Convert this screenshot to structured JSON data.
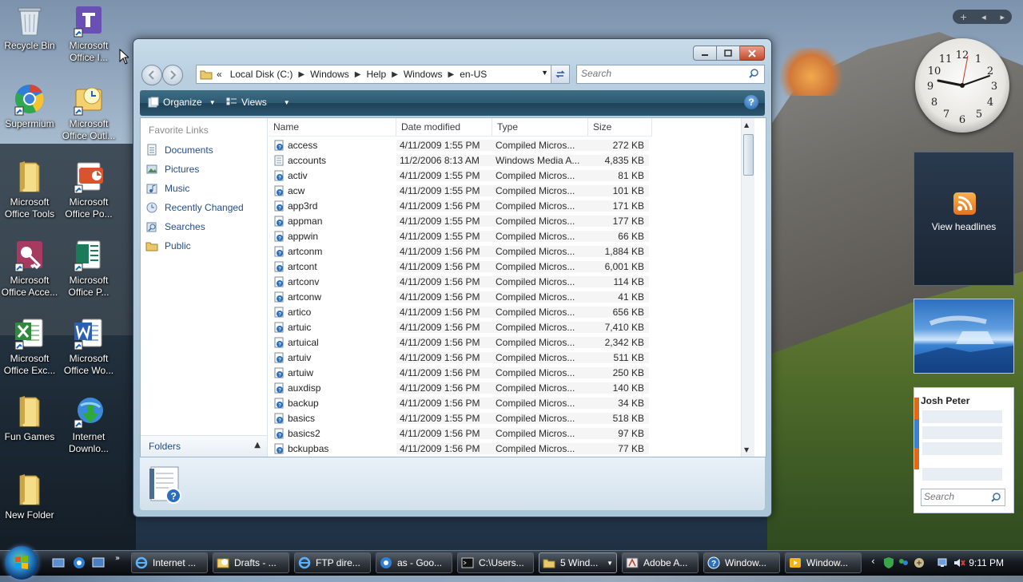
{
  "desktop": {
    "icons": [
      {
        "label": "Recycle Bin",
        "icon": "recycle-bin-icon"
      },
      {
        "label": "Microsoft Office I...",
        "icon": "infopath-icon"
      },
      {
        "label": "Supermium",
        "icon": "browser-icon"
      },
      {
        "label": "Microsoft Office Outl...",
        "icon": "outlook-icon"
      },
      {
        "label": "Microsoft Office Tools",
        "icon": "folder-icon"
      },
      {
        "label": "Microsoft Office Po...",
        "icon": "powerpoint-icon"
      },
      {
        "label": "Microsoft Office Acce...",
        "icon": "access-icon"
      },
      {
        "label": "Microsoft Office P...",
        "icon": "publisher-icon"
      },
      {
        "label": "Microsoft Office Exc...",
        "icon": "excel-icon"
      },
      {
        "label": "Microsoft Office Wo...",
        "icon": "word-icon"
      },
      {
        "label": "Fun Games",
        "icon": "folder-icon"
      },
      {
        "label": "Internet Downlo...",
        "icon": "download-manager-icon"
      },
      {
        "label": "New Folder",
        "icon": "folder-icon"
      }
    ]
  },
  "explorer": {
    "address": [
      "«",
      "Local Disk (C:)",
      "Windows",
      "Help",
      "Windows",
      "en-US"
    ],
    "search_placeholder": "Search",
    "toolbar": {
      "organize": "Organize",
      "views": "Views"
    },
    "favorite_links_title": "Favorite Links",
    "favorite_links": [
      "Documents",
      "Pictures",
      "Music",
      "Recently Changed",
      "Searches",
      "Public"
    ],
    "folders_label": "Folders",
    "columns": {
      "name": "Name",
      "date": "Date modified",
      "type": "Type",
      "size": "Size"
    },
    "files": [
      {
        "name": "access",
        "date": "4/11/2009 1:55 PM",
        "type": "Compiled Micros...",
        "size": "272 KB"
      },
      {
        "name": "accounts",
        "date": "11/2/2006 8:13 AM",
        "type": "Windows Media A...",
        "size": "4,835 KB"
      },
      {
        "name": "activ",
        "date": "4/11/2009 1:55 PM",
        "type": "Compiled Micros...",
        "size": "81 KB"
      },
      {
        "name": "acw",
        "date": "4/11/2009 1:55 PM",
        "type": "Compiled Micros...",
        "size": "101 KB"
      },
      {
        "name": "app3rd",
        "date": "4/11/2009 1:56 PM",
        "type": "Compiled Micros...",
        "size": "171 KB"
      },
      {
        "name": "appman",
        "date": "4/11/2009 1:55 PM",
        "type": "Compiled Micros...",
        "size": "177 KB"
      },
      {
        "name": "appwin",
        "date": "4/11/2009 1:55 PM",
        "type": "Compiled Micros...",
        "size": "66 KB"
      },
      {
        "name": "artconm",
        "date": "4/11/2009 1:56 PM",
        "type": "Compiled Micros...",
        "size": "1,884 KB"
      },
      {
        "name": "artcont",
        "date": "4/11/2009 1:56 PM",
        "type": "Compiled Micros...",
        "size": "6,001 KB"
      },
      {
        "name": "artconv",
        "date": "4/11/2009 1:56 PM",
        "type": "Compiled Micros...",
        "size": "114 KB"
      },
      {
        "name": "artconw",
        "date": "4/11/2009 1:56 PM",
        "type": "Compiled Micros...",
        "size": "41 KB"
      },
      {
        "name": "artico",
        "date": "4/11/2009 1:56 PM",
        "type": "Compiled Micros...",
        "size": "656 KB"
      },
      {
        "name": "artuic",
        "date": "4/11/2009 1:56 PM",
        "type": "Compiled Micros...",
        "size": "7,410 KB"
      },
      {
        "name": "artuical",
        "date": "4/11/2009 1:56 PM",
        "type": "Compiled Micros...",
        "size": "2,342 KB"
      },
      {
        "name": "artuiv",
        "date": "4/11/2009 1:56 PM",
        "type": "Compiled Micros...",
        "size": "511 KB"
      },
      {
        "name": "artuiw",
        "date": "4/11/2009 1:56 PM",
        "type": "Compiled Micros...",
        "size": "250 KB"
      },
      {
        "name": "auxdisp",
        "date": "4/11/2009 1:56 PM",
        "type": "Compiled Micros...",
        "size": "140 KB"
      },
      {
        "name": "backup",
        "date": "4/11/2009 1:56 PM",
        "type": "Compiled Micros...",
        "size": "34 KB"
      },
      {
        "name": "basics",
        "date": "4/11/2009 1:55 PM",
        "type": "Compiled Micros...",
        "size": "518 KB"
      },
      {
        "name": "basics2",
        "date": "4/11/2009 1:56 PM",
        "type": "Compiled Micros...",
        "size": "97 KB"
      },
      {
        "name": "bckupbas",
        "date": "4/11/2009 1:56 PM",
        "type": "Compiled Micros...",
        "size": "77 KB"
      }
    ]
  },
  "gadgets": {
    "rss_label": "View headlines",
    "contacts_name": "Josh Peter",
    "contacts_search_placeholder": "Search"
  },
  "taskbar": {
    "buttons": [
      {
        "label": "Internet ...",
        "icon": "ie-icon"
      },
      {
        "label": "Drafts - ...",
        "icon": "mail-icon"
      },
      {
        "label": "FTP dire...",
        "icon": "ie-icon"
      },
      {
        "label": "as - Goo...",
        "icon": "browser-icon"
      },
      {
        "label": "C:\\Users...",
        "icon": "cmd-icon"
      },
      {
        "label": "5 Wind...",
        "icon": "folder-icon"
      },
      {
        "label": "Adobe A...",
        "icon": "adobe-icon"
      },
      {
        "label": "Window...",
        "icon": "help-icon"
      },
      {
        "label": "Window...",
        "icon": "media-icon"
      }
    ],
    "clock": "9:11 PM"
  },
  "colors": {
    "toolbar": "#2e5a73",
    "link": "#1f4d8c",
    "taskbar": "#161b21"
  }
}
